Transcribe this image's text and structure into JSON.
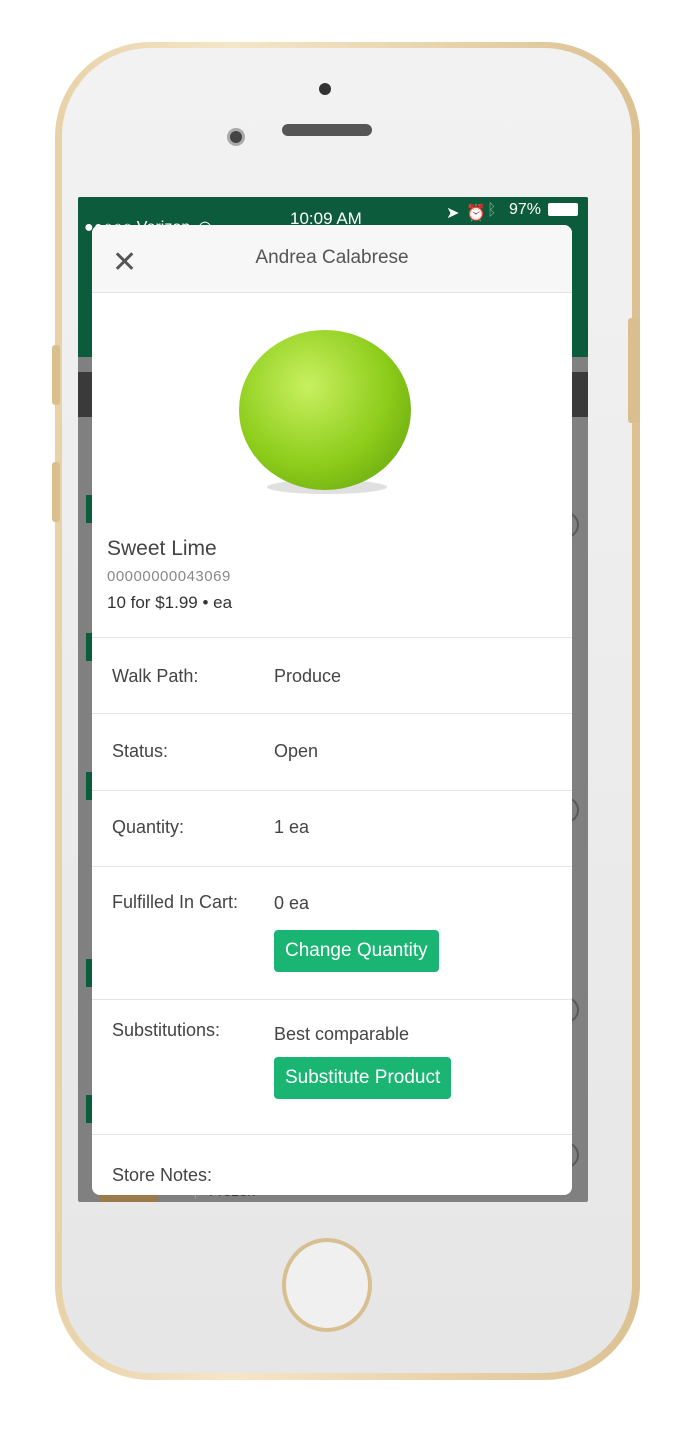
{
  "status_bar": {
    "carrier": "●●○○○ Verizon",
    "time": "10:09 AM",
    "battery": "97%",
    "icons": [
      "wifi-icon",
      "location-icon",
      "alarm-icon",
      "bluetooth-icon",
      "battery-icon"
    ]
  },
  "modal": {
    "title": "Andrea Calabrese",
    "close_icon": "close-icon"
  },
  "product": {
    "name": "Sweet Lime",
    "sku": "00000000043069",
    "price": "10 for $1.99 • ea"
  },
  "details": [
    {
      "label": "Walk Path:",
      "value": "Produce"
    },
    {
      "label": "Status:",
      "value": "Open"
    },
    {
      "label": "Quantity:",
      "value": "1 ea"
    },
    {
      "label": "Fulfilled In Cart:",
      "value": "0 ea",
      "button": "Change Quantity"
    },
    {
      "label": "Substitutions:",
      "value": "Best comparable",
      "button": "Substitute Product"
    },
    {
      "label": "Store Notes:"
    }
  ],
  "background": {
    "aisle": "Frozen"
  },
  "colors": {
    "header_green": "#0c5b3c",
    "button_green": "#1bb573"
  }
}
